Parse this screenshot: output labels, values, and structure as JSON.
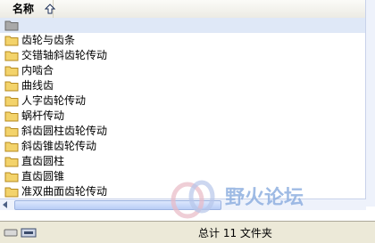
{
  "header": {
    "column_name": "名称"
  },
  "folders": [
    {
      "label": ""
    },
    {
      "label": "齿轮与齿条"
    },
    {
      "label": "交错轴斜齿轮传动"
    },
    {
      "label": "内啮合"
    },
    {
      "label": "曲线齿"
    },
    {
      "label": "人字齿轮传动"
    },
    {
      "label": "蜗杆传动"
    },
    {
      "label": "斜齿圆柱齿轮传动"
    },
    {
      "label": "斜齿锥齿轮传动"
    },
    {
      "label": "直齿圆柱"
    },
    {
      "label": "直齿圆锥"
    },
    {
      "label": "准双曲面齿轮传动"
    }
  ],
  "status": {
    "text": "总计 11 文件夹"
  },
  "watermark": {
    "brand": "野火论坛",
    "url": "www.proewildfire.cn"
  },
  "colors": {
    "folder": "#f3d36b",
    "selected_row": "#dfe8f7",
    "status_bg": "#ece9d8"
  }
}
